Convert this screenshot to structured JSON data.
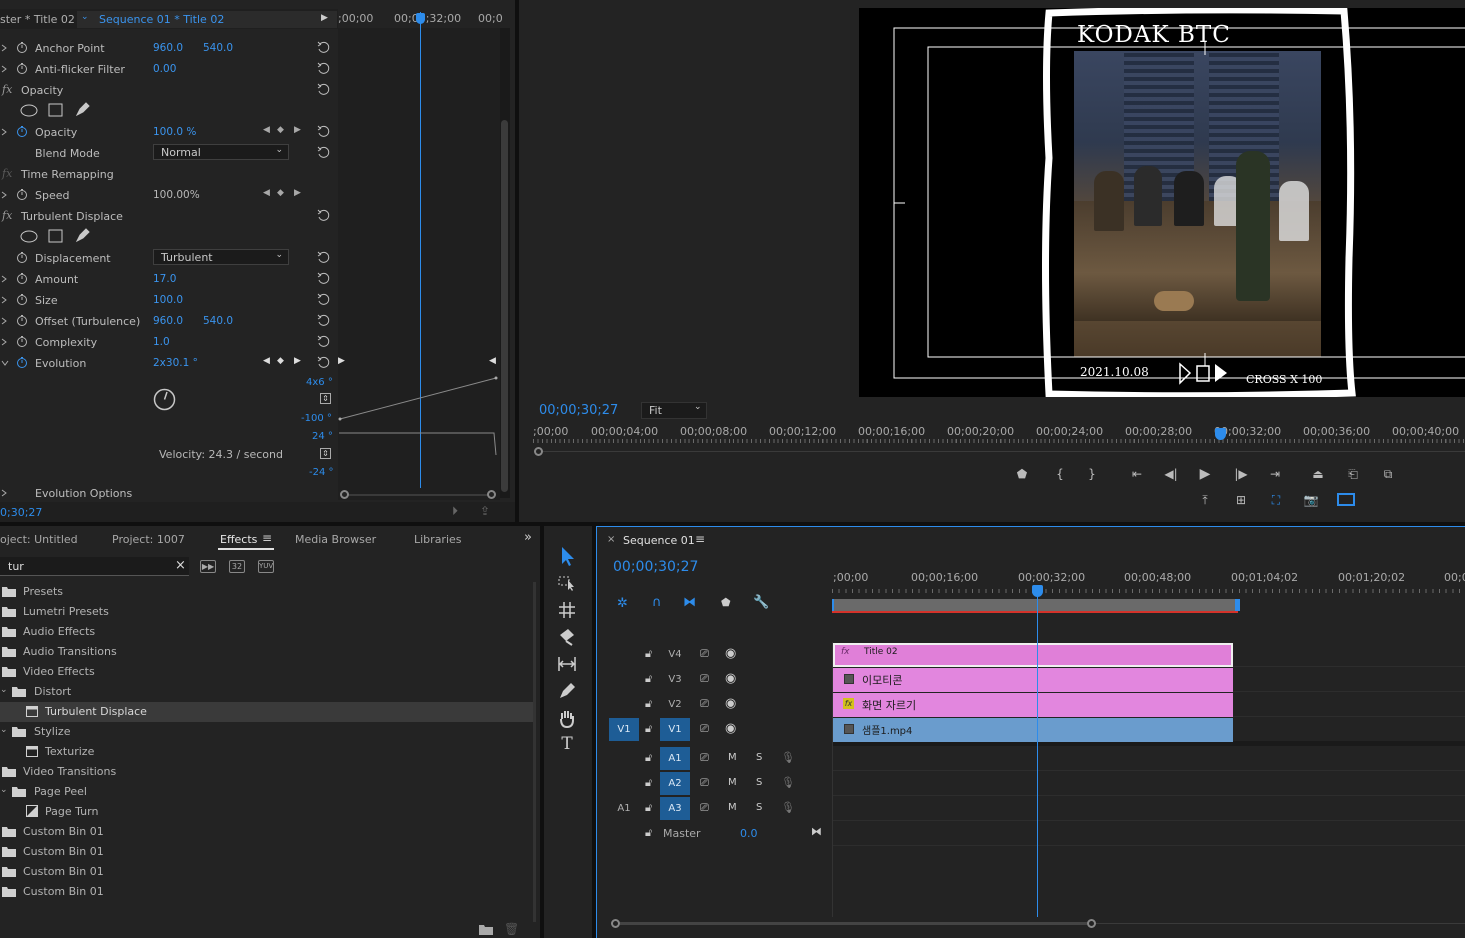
{
  "effect_controls": {
    "tab_master": "ster * Title 02",
    "tab_sequence": "Sequence 01 * Title 02",
    "ruler_ticks": [
      ";00;00",
      "00;00;32;00",
      "00;0"
    ],
    "rows": [
      {
        "label": "Anchor Point",
        "v1": "960.0",
        "v2": "540.0"
      },
      {
        "label": "Anti-flicker Filter",
        "v1": "0.00"
      },
      {
        "label": "Opacity",
        "section": true
      },
      {
        "label": "Opacity",
        "v1": "100.0 %"
      },
      {
        "label": "Blend Mode",
        "dropdown": "Normal"
      },
      {
        "label": "Time Remapping",
        "section": true
      },
      {
        "label": "Speed",
        "v1": "100.00%"
      },
      {
        "label": "Turbulent Displace",
        "section": true
      },
      {
        "label": "Displacement",
        "dropdown": "Turbulent"
      },
      {
        "label": "Amount",
        "v1": "17.0"
      },
      {
        "label": "Size",
        "v1": "100.0"
      },
      {
        "label": "Offset (Turbulence)",
        "v1": "960.0",
        "v2": "540.0"
      },
      {
        "label": "Complexity",
        "v1": "1.0"
      },
      {
        "label": "Evolution",
        "v1": "2x30.1 °"
      }
    ],
    "graph_labels": {
      "top": "4x6 °",
      "bottom": "-100 °",
      "vel_top": "24 °",
      "vel_bottom": "-24 °"
    },
    "velocity": "Velocity: 24.3 / second",
    "evolution_options": "Evolution Options",
    "timecode": "0;30;27"
  },
  "program_monitor": {
    "frame_title": "KODAK BTC",
    "frame_date": "2021.10.08",
    "frame_caption": "CROSS X 100",
    "timecode": "00;00;30;27",
    "fit": "Fit",
    "ruler": [
      ";00;00",
      "00;00;04;00",
      "00;00;08;00",
      "00;00;12;00",
      "00;00;16;00",
      "00;00;20;00",
      "00;00;24;00",
      "00;00;28;00",
      "00;00;32;00",
      "00;00;36;00",
      "00;00;40;00"
    ]
  },
  "project": {
    "tabs": [
      "oject: Untitled",
      "Project: 1007",
      "Effects",
      "Media Browser",
      "Libraries"
    ],
    "search_value": "tur",
    "items": [
      {
        "name": "Presets",
        "indent": 0,
        "type": "bin"
      },
      {
        "name": "Lumetri Presets",
        "indent": 0,
        "type": "bin"
      },
      {
        "name": "Audio Effects",
        "indent": 0,
        "type": "bin"
      },
      {
        "name": "Audio Transitions",
        "indent": 0,
        "type": "bin"
      },
      {
        "name": "Video Effects",
        "indent": 0,
        "type": "bin"
      },
      {
        "name": "Distort",
        "indent": 1,
        "type": "folder"
      },
      {
        "name": "Turbulent Displace",
        "indent": 2,
        "type": "effect",
        "selected": true
      },
      {
        "name": "Stylize",
        "indent": 1,
        "type": "folder"
      },
      {
        "name": "Texturize",
        "indent": 2,
        "type": "effect"
      },
      {
        "name": "Video Transitions",
        "indent": 0,
        "type": "bin"
      },
      {
        "name": "Page Peel",
        "indent": 1,
        "type": "folder"
      },
      {
        "name": "Page Turn",
        "indent": 2,
        "type": "transition"
      },
      {
        "name": "Custom Bin 01",
        "indent": 0,
        "type": "bin"
      },
      {
        "name": "Custom Bin 01",
        "indent": 0,
        "type": "bin"
      },
      {
        "name": "Custom Bin 01",
        "indent": 0,
        "type": "bin"
      },
      {
        "name": "Custom Bin 01",
        "indent": 0,
        "type": "bin"
      }
    ]
  },
  "timeline": {
    "tab": "Sequence 01",
    "timecode": "00;00;30;27",
    "ruler": [
      ";00;00",
      "00;00;16;00",
      "00;00;32;00",
      "00;00;48;00",
      "00;01;04;02",
      "00;01;20;02",
      "00;0"
    ],
    "video_tracks": [
      {
        "name": "V4",
        "clip": "Title 02"
      },
      {
        "name": "V3",
        "clip": "이모티콘"
      },
      {
        "name": "V2",
        "clip": "화면 자르기"
      },
      {
        "name": "V1",
        "clip": "샘플1.mp4",
        "source": "V1"
      }
    ],
    "audio_tracks": [
      {
        "name": "A1",
        "m": "M",
        "s": "S"
      },
      {
        "name": "A2",
        "m": "M",
        "s": "S"
      },
      {
        "name": "A3",
        "m": "M",
        "s": "S",
        "source": "A1"
      }
    ],
    "master_label": "Master",
    "master_value": "0.0"
  }
}
